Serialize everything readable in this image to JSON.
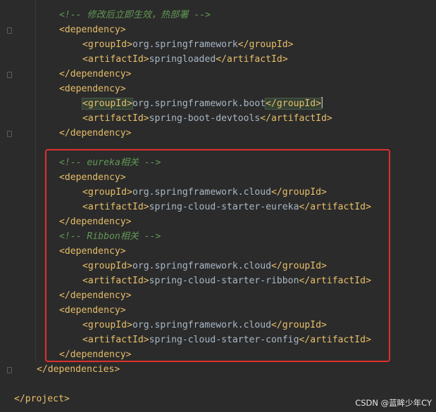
{
  "lines": [
    {
      "indent": 84,
      "parts": [
        {
          "t": "comment",
          "v": "<!-- 修改后立即生效，热部署 -->"
        }
      ]
    },
    {
      "indent": 84,
      "parts": [
        {
          "t": "tag",
          "v": "<dependency>"
        }
      ]
    },
    {
      "indent": 117,
      "parts": [
        {
          "t": "tag",
          "v": "<groupId>"
        },
        {
          "t": "text",
          "v": "org.springframework"
        },
        {
          "t": "tag",
          "v": "</groupId>"
        }
      ]
    },
    {
      "indent": 117,
      "parts": [
        {
          "t": "tag",
          "v": "<artifactId>"
        },
        {
          "t": "text",
          "v": "springloaded"
        },
        {
          "t": "tag",
          "v": "</artifactId>"
        }
      ]
    },
    {
      "indent": 84,
      "parts": [
        {
          "t": "tag",
          "v": "</dependency>"
        }
      ]
    },
    {
      "indent": 84,
      "parts": [
        {
          "t": "tag",
          "v": "<dependency>"
        }
      ]
    },
    {
      "indent": 117,
      "parts": [
        {
          "t": "tag-hl",
          "v": "<groupId>"
        },
        {
          "t": "text",
          "v": "org.springframework.boot"
        },
        {
          "t": "tag-hl-caret",
          "v": "</groupId>"
        }
      ]
    },
    {
      "indent": 117,
      "parts": [
        {
          "t": "tag",
          "v": "<artifactId>"
        },
        {
          "t": "text",
          "v": "spring-boot-devtools"
        },
        {
          "t": "tag",
          "v": "</artifactId>"
        }
      ]
    },
    {
      "indent": 84,
      "parts": [
        {
          "t": "tag",
          "v": "</dependency>"
        }
      ]
    },
    {
      "indent": 84,
      "parts": []
    },
    {
      "indent": 84,
      "parts": [
        {
          "t": "comment",
          "v": "<!-- eureka相关 -->"
        }
      ]
    },
    {
      "indent": 84,
      "parts": [
        {
          "t": "tag",
          "v": "<dependency>"
        }
      ]
    },
    {
      "indent": 117,
      "parts": [
        {
          "t": "tag",
          "v": "<groupId>"
        },
        {
          "t": "text",
          "v": "org.springframework.cloud"
        },
        {
          "t": "tag",
          "v": "</groupId>"
        }
      ]
    },
    {
      "indent": 117,
      "parts": [
        {
          "t": "tag",
          "v": "<artifactId>"
        },
        {
          "t": "text",
          "v": "spring-cloud-starter-eureka"
        },
        {
          "t": "tag",
          "v": "</artifactId>"
        }
      ]
    },
    {
      "indent": 84,
      "parts": [
        {
          "t": "tag",
          "v": "</dependency>"
        }
      ]
    },
    {
      "indent": 84,
      "parts": [
        {
          "t": "comment",
          "v": "<!-- Ribbon相关 -->"
        }
      ]
    },
    {
      "indent": 84,
      "parts": [
        {
          "t": "tag",
          "v": "<dependency>"
        }
      ]
    },
    {
      "indent": 117,
      "parts": [
        {
          "t": "tag",
          "v": "<groupId>"
        },
        {
          "t": "text",
          "v": "org.springframework.cloud"
        },
        {
          "t": "tag",
          "v": "</groupId>"
        }
      ]
    },
    {
      "indent": 117,
      "parts": [
        {
          "t": "tag",
          "v": "<artifactId>"
        },
        {
          "t": "text",
          "v": "spring-cloud-starter-ribbon"
        },
        {
          "t": "tag",
          "v": "</artifactId>"
        }
      ]
    },
    {
      "indent": 84,
      "parts": [
        {
          "t": "tag",
          "v": "</dependency>"
        }
      ]
    },
    {
      "indent": 84,
      "parts": [
        {
          "t": "tag",
          "v": "<dependency>"
        }
      ]
    },
    {
      "indent": 117,
      "parts": [
        {
          "t": "tag",
          "v": "<groupId>"
        },
        {
          "t": "text",
          "v": "org.springframework.cloud"
        },
        {
          "t": "tag",
          "v": "</groupId>"
        }
      ]
    },
    {
      "indent": 117,
      "parts": [
        {
          "t": "tag",
          "v": "<artifactId>"
        },
        {
          "t": "text",
          "v": "spring-cloud-starter-config"
        },
        {
          "t": "tag",
          "v": "</artifactId>"
        }
      ]
    },
    {
      "indent": 84,
      "parts": [
        {
          "t": "tag",
          "v": "</dependency>"
        }
      ]
    },
    {
      "indent": 52,
      "parts": [
        {
          "t": "tag",
          "v": "</dependencies>"
        }
      ]
    },
    {
      "indent": 20,
      "parts": []
    },
    {
      "indent": 20,
      "parts": [
        {
          "t": "tag",
          "v": "</project>"
        }
      ]
    }
  ],
  "watermark": "CSDN @蓝眸少年CY",
  "colors": {
    "background": "#2b2b2b",
    "tag": "#e8bf6a",
    "text": "#a9b7c6",
    "comment": "#629755",
    "annotation_border": "#e0302c"
  },
  "fold_marker_icon": "fold-marker-icon"
}
